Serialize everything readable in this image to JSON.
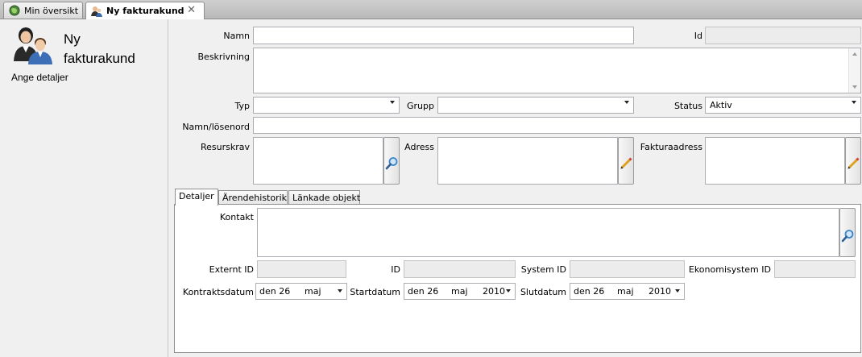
{
  "tabs": [
    {
      "label": "Min översikt",
      "active": false
    },
    {
      "label": "Ny fakturakund",
      "active": true,
      "close": "✕"
    }
  ],
  "side": {
    "title": "Ny fakturakund",
    "subtitle": "Ange detaljer",
    "icon": "customer-avatar-icon"
  },
  "form": {
    "namn_label": "Namn",
    "namn_value": "",
    "id_label": "Id",
    "id_value": "",
    "beskrivning_label": "Beskrivning",
    "beskrivning_value": "",
    "typ_label": "Typ",
    "typ_value": "",
    "grupp_label": "Grupp",
    "grupp_value": "",
    "status_label": "Status",
    "status_value": "Aktiv",
    "namn_losenord_label": "Namn/lösenord",
    "namn_losenord_value": "",
    "resurskrav_label": "Resurskrav",
    "adress_label": "Adress",
    "fakturaadress_label": "Fakturaadress"
  },
  "subtabs": [
    "Detaljer",
    "Ärendehistorik",
    "Länkade objekt"
  ],
  "details": {
    "kontakt_label": "Kontakt",
    "externt_id_label": "Externt ID",
    "id_label": "ID",
    "system_id_label": "System ID",
    "ekonomisystem_id_label": "Ekonomisystem ID",
    "kontraktsdatum_label": "Kontraktsdatum",
    "kontraktsdatum": {
      "day": "den 26",
      "month": "maj",
      "year": ""
    },
    "startdatum_label": "Startdatum",
    "startdatum": {
      "day": "den 26",
      "month": "maj",
      "year": "2010"
    },
    "slutdatum_label": "Slutdatum",
    "slutdatum": {
      "day": "den 26",
      "month": "maj",
      "year": "2010"
    }
  },
  "colors": {
    "accent_search": "#3a87c8",
    "edit_pencil": "#e0a020"
  }
}
